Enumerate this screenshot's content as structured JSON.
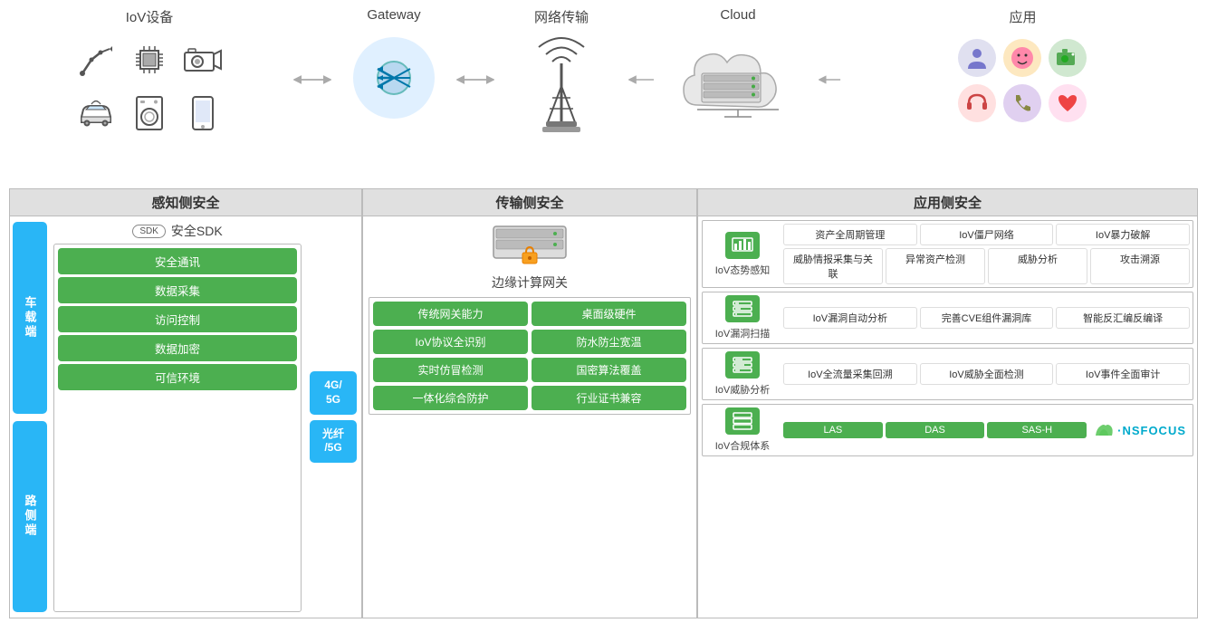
{
  "header": {
    "iov_label": "IoV设备",
    "gateway_label": "Gateway",
    "network_label": "网络传输",
    "cloud_label": "Cloud",
    "app_label": "应用"
  },
  "sections": {
    "perception": "感知侧安全",
    "transmission": "传输侧安全",
    "application": "应用侧安全"
  },
  "left_panel": {
    "vehicle_label": "车载端",
    "road_label": "路侧端",
    "sdk_badge": "SDK",
    "sdk_name": "安全SDK",
    "pills": [
      "安全通讯",
      "数据采集",
      "访问控制",
      "数据加密",
      "可信环境"
    ],
    "net1": "4G/\n5G",
    "net2": "光纤\n/5G"
  },
  "mid_panel": {
    "edge_label": "边缘计算网关",
    "grid_items": [
      "传统网关能力",
      "桌面级硬件",
      "IoV协议全识别",
      "防水防尘宽温",
      "实时仿冒检测",
      "国密算法覆盖",
      "一体化综合防护",
      "行业证书兼容"
    ]
  },
  "right_panel": {
    "rows": [
      {
        "icon_label": "IoV态势感知",
        "pills_row1": [
          "资产全周期管理",
          "IoV僵尸网络",
          "IoV暴力破解"
        ],
        "pills_row2": [
          "威胁情报采集与关联",
          "异常资产检测",
          "威胁分析",
          "攻击溯源"
        ]
      },
      {
        "icon_label": "IoV漏洞扫描",
        "pills_row1": [
          "IoV漏洞自动分析",
          "完善CVE组件漏洞库",
          "智能反汇编反编译"
        ]
      },
      {
        "icon_label": "IoV威胁分析",
        "pills_row1": [
          "IoV全流量采集回溯",
          "IoV威胁全面检测",
          "IoV事件全面审计"
        ]
      },
      {
        "icon_label": "IoV合规体系",
        "pills_row1": [
          "LAS",
          "DAS",
          "SAS-H"
        ],
        "nsfocus": true
      }
    ]
  },
  "icons": {
    "robot_arm": "🦾",
    "chip": "💻",
    "camera": "📷",
    "car": "🚗",
    "washer": "🫙",
    "phone": "📱",
    "gateway": "⚡",
    "tower": "📡",
    "cloud": "☁",
    "app_icons": [
      "👤",
      "🙂",
      "📷",
      "🎧",
      "☎",
      "❤"
    ]
  }
}
